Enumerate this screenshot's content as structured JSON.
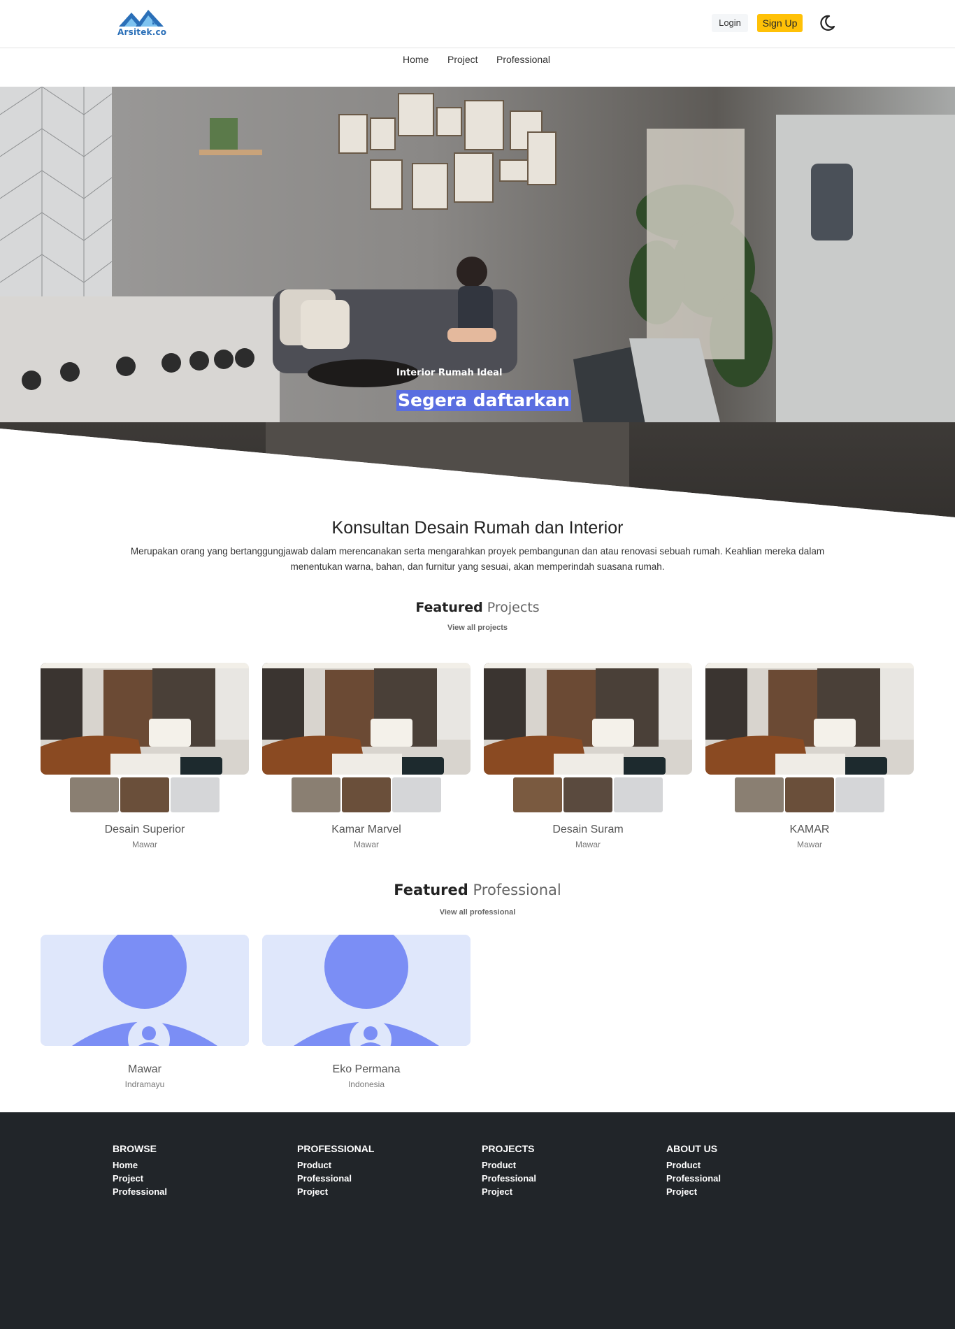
{
  "brand": {
    "name": "Arsitek.co",
    "logo_color": "#2a6fb8"
  },
  "header": {
    "login_label": "Login",
    "signup_label": "Sign Up",
    "theme_toggle_icon": "moon-icon"
  },
  "nav": {
    "items": [
      "Home",
      "Project",
      "Professional"
    ]
  },
  "hero": {
    "subtitle": "Interior Rumah Ideal",
    "title": "Segera daftarkan"
  },
  "intro": {
    "title": "Konsultan Desain Rumah dan Interior",
    "text": "Merupakan orang yang bertanggungjawab dalam merencanakan serta mengarahkan proyek pembangunan dan atau renovasi sebuah rumah. Keahlian mereka dalam menentukan warna, bahan, dan furnitur yang sesuai, akan memperindah suasana rumah."
  },
  "featured_projects": {
    "title_bold": "Featured",
    "title_light": "Projects",
    "link": "View all projects",
    "items": [
      {
        "name": "Desain Superior",
        "owner": "Mawar"
      },
      {
        "name": "Kamar Marvel",
        "owner": "Mawar"
      },
      {
        "name": "Desain Suram",
        "owner": "Mawar"
      },
      {
        "name": "KAMAR",
        "owner": "Mawar"
      }
    ]
  },
  "featured_professional": {
    "title_bold": "Featured",
    "title_light": "Professional",
    "link": "View all professional",
    "items": [
      {
        "name": "Mawar",
        "location": "Indramayu"
      },
      {
        "name": "Eko Permana",
        "location": "Indonesia"
      }
    ]
  },
  "footer": {
    "columns": [
      {
        "heading": "BROWSE",
        "links": [
          "Home",
          "Project",
          "Professional"
        ]
      },
      {
        "heading": "PROFESSIONAL",
        "links": [
          "Product",
          "Professional",
          "Project"
        ]
      },
      {
        "heading": "PROJECTS",
        "links": [
          "Product",
          "Professional",
          "Project"
        ]
      },
      {
        "heading": "ABOUT US",
        "links": [
          "Product",
          "Professional",
          "Project"
        ]
      }
    ]
  },
  "colors": {
    "accent": "#ffc107",
    "highlight": "#5a6ee0",
    "footer_bg": "#212529",
    "avatar": "#7b8ef5"
  }
}
